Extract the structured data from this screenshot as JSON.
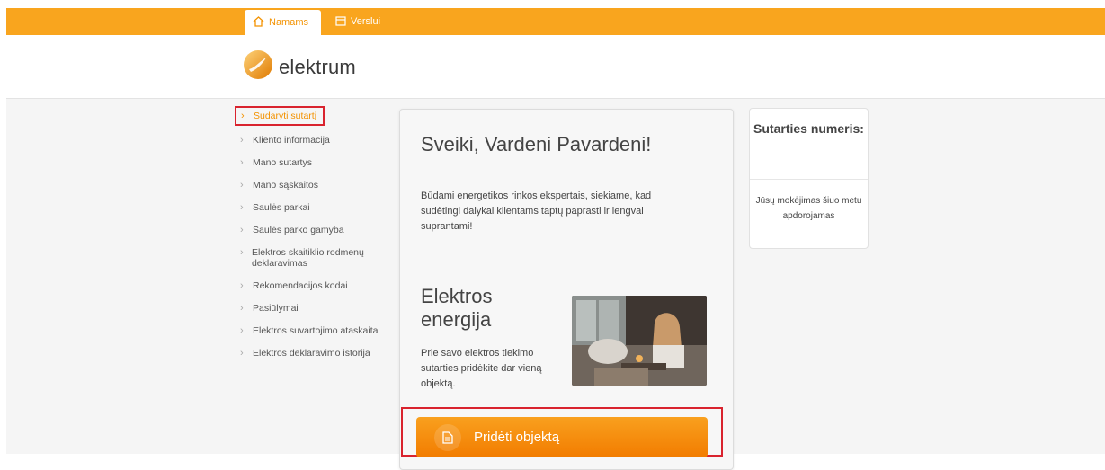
{
  "topnav": {
    "tabs": [
      {
        "label": "Namams",
        "icon": "home-icon"
      },
      {
        "label": "Verslui",
        "icon": "calendar-icon"
      }
    ]
  },
  "brand": {
    "name": "elektrum"
  },
  "sidebar": {
    "items": [
      {
        "label": "Sudaryti sutartį"
      },
      {
        "label": "Kliento informacija"
      },
      {
        "label": "Mano sutartys"
      },
      {
        "label": "Mano sąskaitos"
      },
      {
        "label": "Saulės parkai"
      },
      {
        "label": "Saulės parko gamyba"
      },
      {
        "label": "Elektros skaitiklio rodmenų deklaravimas"
      },
      {
        "label": "Rekomendacijos kodai"
      },
      {
        "label": "Pasiūlymai"
      },
      {
        "label": "Elektros suvartojimo ataskaita"
      },
      {
        "label": "Elektros deklaravimo istorija"
      }
    ]
  },
  "main": {
    "greeting": "Sveiki, Vardeni Pavardeni!",
    "intro": "Būdami energetikos rinkos ekspertais, siekiame, kad sudėtingi dalykai klientams taptų paprasti ir lengvai suprantami!",
    "section_title": "Elektros energija",
    "section_desc": "Prie savo elektros tiekimo sutarties pridėkite dar vieną objektą.",
    "add_button": "Pridėti objektą"
  },
  "contract": {
    "title": "Sutarties numeris:",
    "status": "Jūsų mokėjimas šiuo metu apdorojamas"
  },
  "colors": {
    "brand_orange": "#f9a51e",
    "button_orange": "#f27c00",
    "highlight_red": "#d9232e"
  }
}
